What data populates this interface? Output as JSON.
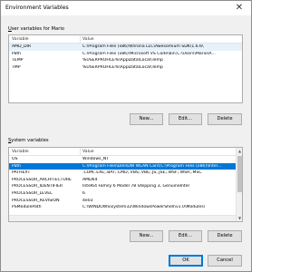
{
  "window": {
    "title": "Environment Variables"
  },
  "user_vars": {
    "label_prefix": "",
    "label_u": "U",
    "label_rest": "ser variables for Mario",
    "columns": [
      "Variable",
      "Value"
    ],
    "rows": [
      {
        "variable": "AMD_DIR",
        "value": "C:\\Program Files (x86)\\Khrona LLC\\Awesomium SDK\\1.6.6\\"
      },
      {
        "variable": "Path",
        "value": "C:\\Program Files (x86)\\Microsoft VS Code\\bin;C:\\Users\\Mario\\A..."
      },
      {
        "variable": "TEMP",
        "value": "%USERPROFILE%\\AppData\\Local\\Temp"
      },
      {
        "variable": "TMP",
        "value": "%USERPROFILE%\\AppData\\Local\\Temp"
      }
    ],
    "buttons": {
      "new": "New...",
      "edit": "Edit...",
      "delete": "Delete"
    }
  },
  "system_vars": {
    "label_u": "S",
    "label_rest": "ystem variables",
    "columns": [
      "Variable",
      "Value"
    ],
    "rows": [
      {
        "variable": "OS",
        "value": "Windows_NT"
      },
      {
        "variable": "Path",
        "value": "C:\\Program Files\\Dell\\DW WLAN Card;C:\\Program Files (x86)\\Intel..."
      },
      {
        "variable": "PATHEXT",
        "value": ".COM;.EXE;.BAT;.CMD;.VBS;.VBE;.JS;.JSE;.WSF;.WSH;.MSC"
      },
      {
        "variable": "PROCESSOR_ARCHITECTURE",
        "value": "AMD64"
      },
      {
        "variable": "PROCESSOR_IDENTIFIER",
        "value": "Intel64 Family 6 Model 78 Stepping 3, GenuineIntel"
      },
      {
        "variable": "PROCESSOR_LEVEL",
        "value": "6"
      },
      {
        "variable": "PROCESSOR_REVISION",
        "value": "4e03"
      },
      {
        "variable": "PSModulePath",
        "value": "C:\\WINDOWS\\system32\\WindowsPowerShell\\v1.0\\Modules\\"
      }
    ],
    "selected_index": 1,
    "buttons": {
      "new": "New...",
      "edit": "Edit...",
      "delete": "Delete"
    }
  },
  "footer": {
    "ok": "OK",
    "cancel": "Cancel"
  },
  "colors": {
    "selection": "#0078d7",
    "window_bg": "#f0f0f0"
  },
  "icons": {
    "close": "close-icon",
    "scroll_up": "scroll-up-icon",
    "scroll_down": "scroll-down-icon"
  }
}
